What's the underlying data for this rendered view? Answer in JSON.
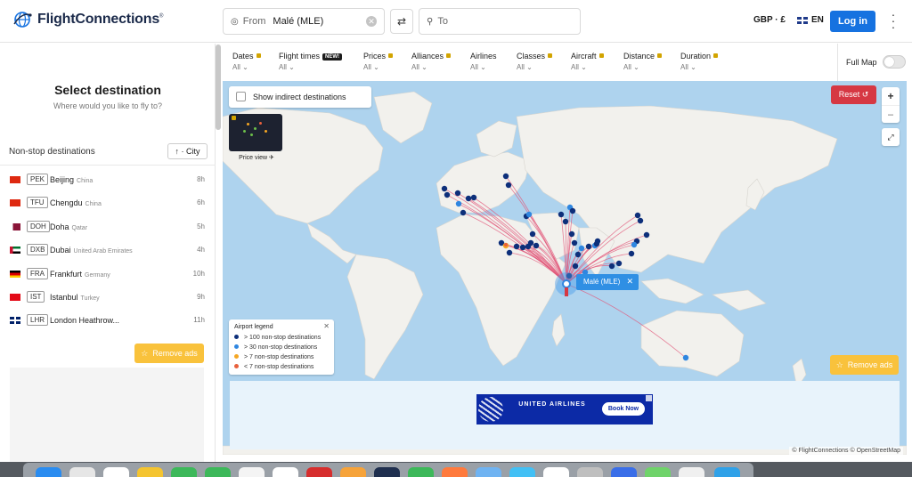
{
  "header": {
    "brand": "FlightConnections",
    "brand_mark": "®",
    "from_label": "From",
    "from_value": "Malé (MLE)",
    "to_placeholder": "To",
    "currency": "GBP · £",
    "language": "EN",
    "login_label": "Log in"
  },
  "left_panel": {
    "title": "Select destination",
    "subtitle": "Where would you like to fly to?",
    "nonstop_title": "Non-stop destinations",
    "sort_label": "↑ · City",
    "destinations": [
      {
        "code": "PEK",
        "city": "Beijing",
        "country": "China",
        "hours": "8h",
        "flag": "cn"
      },
      {
        "code": "TFU",
        "city": "Chengdu",
        "country": "China",
        "hours": "6h",
        "flag": "cn"
      },
      {
        "code": "DOH",
        "city": "Doha",
        "country": "Qatar",
        "hours": "5h",
        "flag": "qa"
      },
      {
        "code": "DXB",
        "city": "Dubai",
        "country": "United Arab Emirates",
        "hours": "4h",
        "flag": "ae"
      },
      {
        "code": "FRA",
        "city": "Frankfurt",
        "country": "Germany",
        "hours": "10h",
        "flag": "de"
      },
      {
        "code": "IST",
        "city": "Istanbul",
        "country": "Turkey",
        "hours": "9h",
        "flag": "tr"
      },
      {
        "code": "LHR",
        "city": "London Heathrow...",
        "country": "",
        "hours": "11h",
        "flag": "gb"
      }
    ],
    "remove_ads": "Remove ads"
  },
  "filters": [
    {
      "label": "Dates",
      "value": "All",
      "locked": true,
      "new": false
    },
    {
      "label": "Flight times",
      "value": "All",
      "locked": false,
      "new": true
    },
    {
      "label": "Prices",
      "value": "All",
      "locked": true,
      "new": false
    },
    {
      "label": "Alliances",
      "value": "All",
      "locked": true,
      "new": false
    },
    {
      "label": "Airlines",
      "value": "All",
      "locked": false,
      "new": false
    },
    {
      "label": "Classes",
      "value": "All",
      "locked": true,
      "new": false
    },
    {
      "label": "Aircraft",
      "value": "All",
      "locked": true,
      "new": false
    },
    {
      "label": "Distance",
      "value": "All",
      "locked": true,
      "new": false
    },
    {
      "label": "Duration",
      "value": "All",
      "locked": true,
      "new": false
    }
  ],
  "new_badge": "NEW!",
  "full_map_label": "Full Map",
  "map": {
    "indirect_label": "Show indirect destinations",
    "price_view_label": "Price view",
    "reset_label": "Reset",
    "selected_airport_label": "Malé (MLE)",
    "legend": {
      "title": "Airport legend",
      "items": [
        {
          "label": "> 100 non-stop destinations",
          "color": "#0d2f7a"
        },
        {
          "label": "> 30 non-stop destinations",
          "color": "#2f86e0"
        },
        {
          "label": "> 7 non-stop destinations",
          "color": "#f5a623"
        },
        {
          "label": "< 7 non-stop destinations",
          "color": "#e8603c"
        }
      ]
    },
    "remove_ads": "Remove ads",
    "attribution": "© FlightConnections © OpenStreetMap"
  },
  "ad_banner": {
    "brand": "UNITED AIRLINES",
    "cta": "Book Now"
  },
  "colors": {
    "accent": "#1672e0",
    "route_line": "#e2577a",
    "water": "#aed3ee",
    "land": "#f2f1ed",
    "reset": "#d63843",
    "ads": "#f9c23c"
  }
}
